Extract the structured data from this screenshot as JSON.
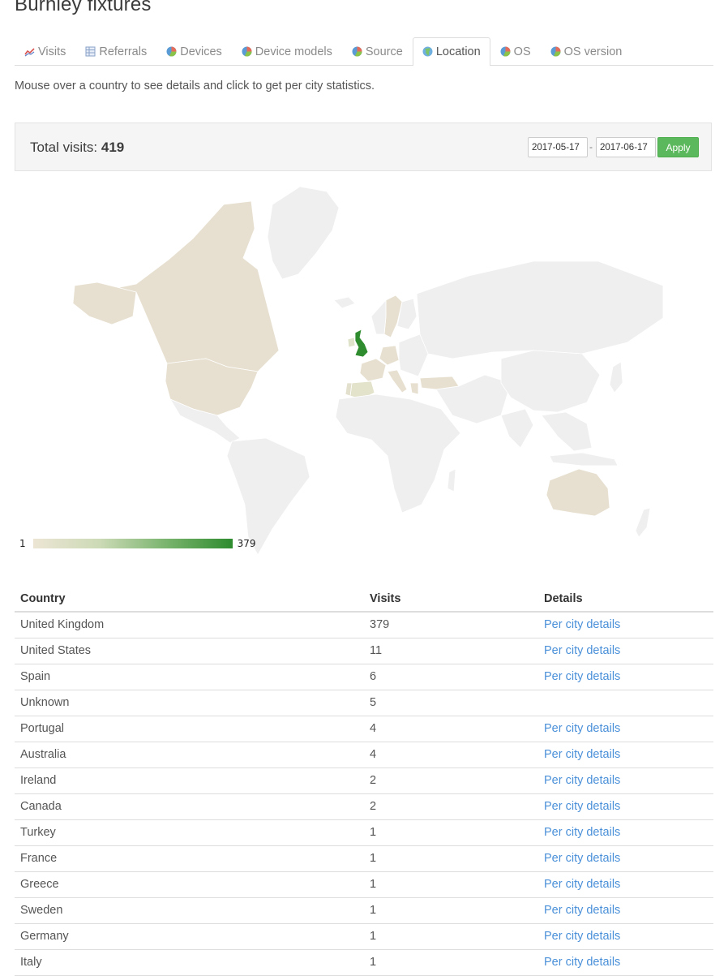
{
  "page_title": "Burnley fixtures",
  "tabs": [
    {
      "label": "Visits",
      "icon": "line-chart-icon",
      "active": false
    },
    {
      "label": "Referrals",
      "icon": "table-icon",
      "active": false
    },
    {
      "label": "Devices",
      "icon": "pie-chart-icon",
      "active": false
    },
    {
      "label": "Device models",
      "icon": "pie-chart-icon",
      "active": false
    },
    {
      "label": "Source",
      "icon": "pie-chart-icon",
      "active": false
    },
    {
      "label": "Location",
      "icon": "globe-icon",
      "active": true
    },
    {
      "label": "OS",
      "icon": "pie-chart-icon",
      "active": false
    },
    {
      "label": "OS version",
      "icon": "pie-chart-icon",
      "active": false
    }
  ],
  "intro_text": "Mouse over a country to see details and click to get per city statistics.",
  "summary": {
    "total_label": "Total visits:",
    "total_value": "419",
    "date_from": "2017-05-17",
    "date_separator": "-",
    "date_to": "2017-06-17",
    "apply_label": "Apply"
  },
  "legend": {
    "min": "1",
    "max": "379"
  },
  "colors": {
    "map_land": "#efefef",
    "map_low": "#e7e0d0",
    "map_high": "#2e8b2e",
    "apply_button": "#5cb85c",
    "link": "#4a90d9"
  },
  "table": {
    "headers": {
      "country": "Country",
      "visits": "Visits",
      "details": "Details"
    },
    "rows": [
      {
        "country": "United Kingdom",
        "visits": "379",
        "details": "Per city details"
      },
      {
        "country": "United States",
        "visits": "11",
        "details": "Per city details"
      },
      {
        "country": "Spain",
        "visits": "6",
        "details": "Per city details"
      },
      {
        "country": "Unknown",
        "visits": "5",
        "details": ""
      },
      {
        "country": "Portugal",
        "visits": "4",
        "details": "Per city details"
      },
      {
        "country": "Australia",
        "visits": "4",
        "details": "Per city details"
      },
      {
        "country": "Ireland",
        "visits": "2",
        "details": "Per city details"
      },
      {
        "country": "Canada",
        "visits": "2",
        "details": "Per city details"
      },
      {
        "country": "Turkey",
        "visits": "1",
        "details": "Per city details"
      },
      {
        "country": "France",
        "visits": "1",
        "details": "Per city details"
      },
      {
        "country": "Greece",
        "visits": "1",
        "details": "Per city details"
      },
      {
        "country": "Sweden",
        "visits": "1",
        "details": "Per city details"
      },
      {
        "country": "Germany",
        "visits": "1",
        "details": "Per city details"
      },
      {
        "country": "Italy",
        "visits": "1",
        "details": "Per city details"
      }
    ]
  }
}
